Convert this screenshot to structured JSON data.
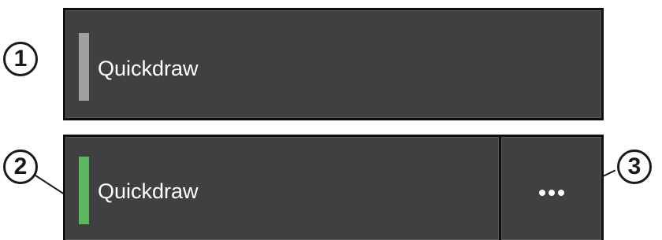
{
  "callouts": {
    "one": "1",
    "two": "2",
    "three": "3"
  },
  "tile_off": {
    "label": "Quickdraw",
    "status": "inactive",
    "status_color": "#a0a0a0"
  },
  "tile_on": {
    "label": "Quickdraw",
    "status": "active",
    "status_color": "#5cb85c",
    "more_icon": "ellipsis-icon"
  },
  "colors": {
    "panel_border": "#0f0f0f",
    "tile_background": "#404042",
    "label_text": "#ffffff",
    "callout_ring": "#1a1a1a"
  }
}
